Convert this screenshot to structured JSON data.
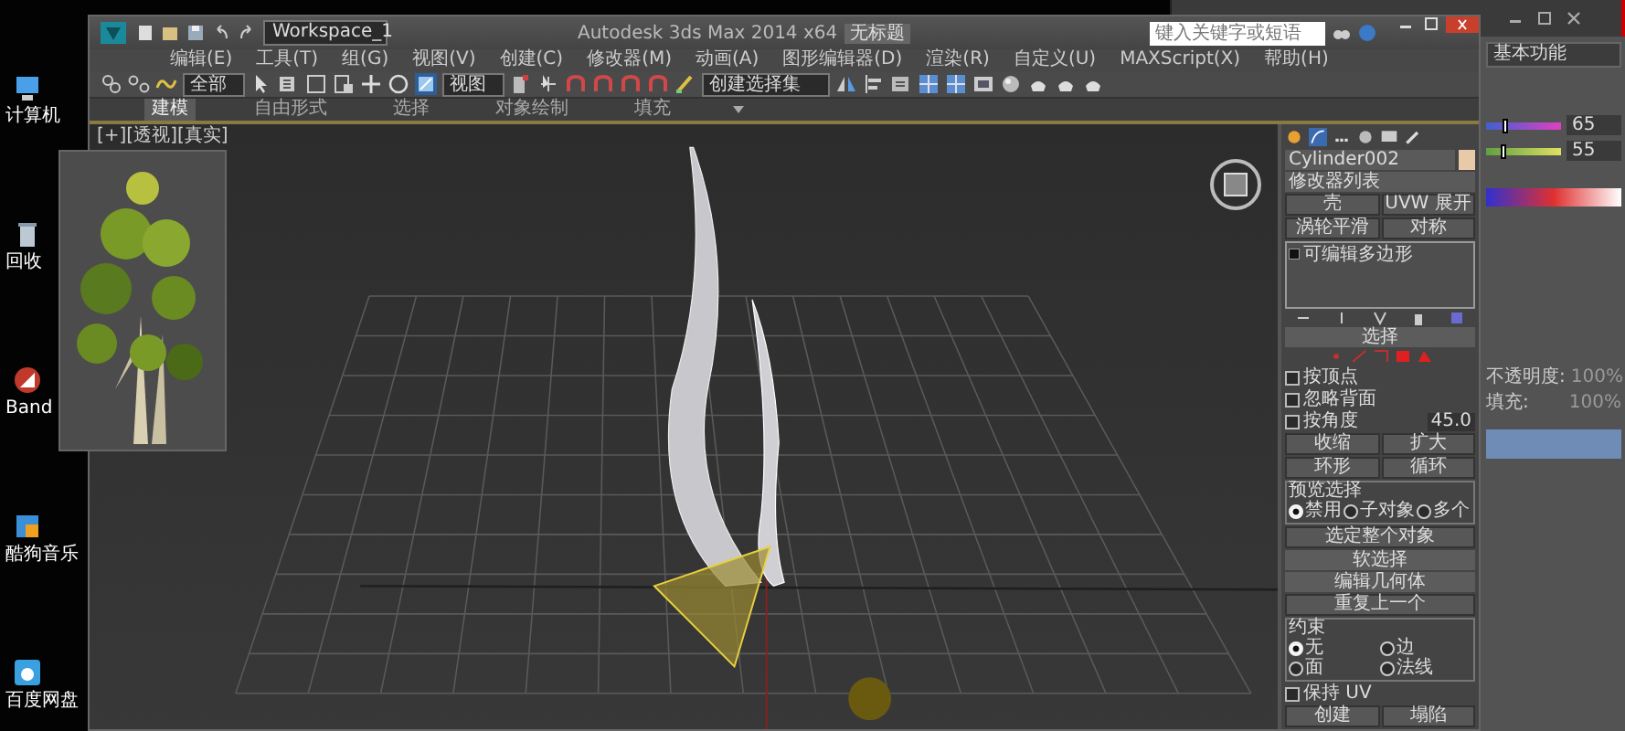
{
  "desktop_icons": [
    {
      "label": "计算机",
      "kind": "computer"
    },
    {
      "label": "回收",
      "kind": "recycle"
    },
    {
      "label": "Band",
      "kind": "app"
    },
    {
      "label": "酷狗音乐",
      "kind": "music"
    },
    {
      "label": "百度网盘",
      "kind": "cloud"
    }
  ],
  "background_window": {
    "workspace": "基本功能",
    "color_sliders": [
      {
        "value": "65",
        "level": 0.25
      },
      {
        "value": "55",
        "level": 0.22
      }
    ],
    "opacity_label": "不透明度:",
    "opacity_value": "100%",
    "fill_label": "填充:",
    "fill_value": "100%"
  },
  "max_window": {
    "workspace": "Workspace_1",
    "title": "Autodesk 3ds Max 2014 x64",
    "document": "无标题",
    "search": {
      "placeholder": "键入关键字或短语"
    },
    "menus": [
      "编辑(E)",
      "工具(T)",
      "组(G)",
      "视图(V)",
      "创建(C)",
      "修改器(M)",
      "动画(A)",
      "图形编辑器(D)",
      "渲染(R)",
      "自定义(U)",
      "MAXScript(X)",
      "帮助(H)"
    ],
    "selection_filter": "全部",
    "reference_coordinate": "视图",
    "named_selection": "创建选择集",
    "ribbon_tabs": [
      {
        "label": "建模",
        "selected": true
      },
      {
        "label": "自由形式",
        "selected": false
      },
      {
        "label": "选择",
        "selected": false
      },
      {
        "label": "对象绘制",
        "selected": false
      },
      {
        "label": "填充",
        "selected": false
      }
    ],
    "viewport_label": "[+][透视][真实]",
    "command_panel": {
      "object_name": "Cylinder002",
      "modifier_list": "修改器列表",
      "modifier_buttons": [
        "壳",
        "UVW 展开",
        "涡轮平滑",
        "对称"
      ],
      "stack": [
        "可编辑多边形"
      ],
      "selection": {
        "title": "选择",
        "checkboxes": [
          {
            "label": "按顶点",
            "checked": false
          },
          {
            "label": "忽略背面",
            "checked": false
          },
          {
            "label": "按角度",
            "checked": false
          }
        ],
        "angle": "45.0",
        "buttons": [
          "收缩",
          "扩大",
          "环形",
          "循环"
        ],
        "preview": {
          "title": "预览选择",
          "options": [
            {
              "label": "禁用",
              "selected": true
            },
            {
              "label": "子对象",
              "selected": false
            },
            {
              "label": "多个",
              "selected": false
            }
          ]
        },
        "whole_object_button": "选定整个对象"
      },
      "soft_selection": "软选择",
      "edit_geometry": {
        "title": "编辑几何体",
        "repeat_button": "重复上一个",
        "constraints": {
          "title": "约束",
          "options": [
            {
              "label": "无",
              "selected": true
            },
            {
              "label": "边",
              "selected": false
            },
            {
              "label": "面",
              "selected": false
            },
            {
              "label": "法线",
              "selected": false
            }
          ]
        },
        "preserve_uv": {
          "label": "保持 UV",
          "checked": false
        },
        "buttons": [
          "创建",
          "塌陷"
        ]
      }
    }
  }
}
